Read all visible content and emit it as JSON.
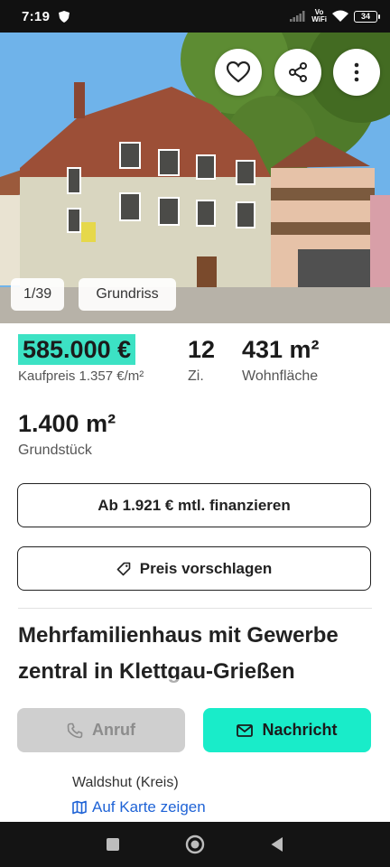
{
  "status_bar": {
    "time": "7:19",
    "volte_top": "Vo",
    "volte_bottom": "WiFi",
    "battery": "34"
  },
  "gallery": {
    "counter": "1/39",
    "floorplan_label": "Grundriss"
  },
  "price": {
    "value": "585.000 €",
    "sub": "Kaufpreis 1.357 €/m²"
  },
  "rooms": {
    "value": "12",
    "label": "Zi."
  },
  "living_area": {
    "value": "431 m²",
    "label": "Wohnfläche"
  },
  "plot_area": {
    "value": "1.400 m²",
    "label": "Grundstück"
  },
  "financing_button": "Ab 1.921 € mtl. finanzieren",
  "propose_price_button": "Preis vorschlagen",
  "listing_title": "Mehrfamilienhaus mit Gewerbe zentral in Klettgau-Grießen",
  "actions": {
    "call": "Anruf",
    "message": "Nachricht"
  },
  "location": {
    "district": "Waldshut (Kreis)",
    "map_link": "Auf Karte zeigen"
  },
  "colors": {
    "accent": "#19ecc9",
    "price_highlight": "#3ce2c4",
    "link": "#1f63d6"
  },
  "icons": [
    "heart-icon",
    "share-icon",
    "more-vertical-icon",
    "tag-icon",
    "phone-icon",
    "mail-icon",
    "map-icon",
    "nav-recent-icon",
    "nav-home-icon",
    "nav-back-icon"
  ]
}
